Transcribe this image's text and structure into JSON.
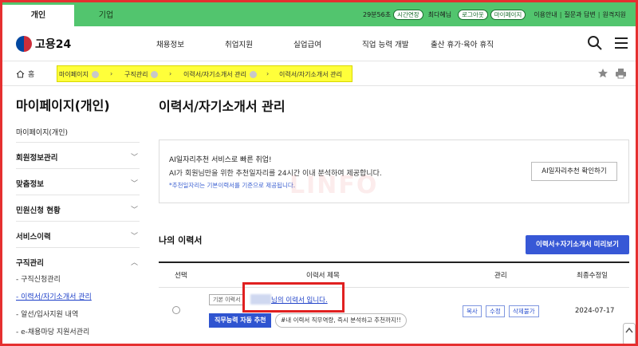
{
  "topbar": {
    "tabs": [
      "개인",
      "기업"
    ],
    "session_time": "29분56초",
    "extend_label": "시간연장",
    "user": "최다혜님",
    "logout_label": "로그아웃",
    "mypage_label": "마이페이지",
    "links": [
      "이용안내",
      "질문과 답변",
      "원격지원"
    ]
  },
  "header": {
    "logo": "고용24",
    "menu": [
      "채용정보",
      "취업지원",
      "실업급여",
      "직업 능력 개발",
      "출산 휴가·육아 휴직"
    ]
  },
  "breadcrumb": {
    "home": "홈",
    "items": [
      "마이페이지",
      "구직관리",
      "이력서/자기소개서 관리",
      "이력서/자기소개서 관리"
    ]
  },
  "sidebar": {
    "title": "마이페이지(개인)",
    "subtitle": "마이페이지(개인)",
    "items": [
      "회원정보관리",
      "맞춤정보",
      "민원신청 현황",
      "서비스이력",
      "구직관리"
    ],
    "sublinks": [
      "- 구직신청관리",
      "- 이력서/자기소개서 관리",
      "- 알선/입사지원 내역",
      "- e-채용마당 지원서관리"
    ]
  },
  "main": {
    "title": "이력서/자기소개서 관리",
    "ai_box": {
      "line1": "AI일자리추천 서비스로 빠른 취업!",
      "line2": "AI가 회원님만을 위한 추천일자리를 24시간 이내 분석하여 제공합니다.",
      "note": "*추천일자리는 기본이력서를 기준으로 제공됩니다.",
      "button": "AI일자리추천 확인하기"
    },
    "watermark": "LINFO",
    "my_resume_title": "나의 이력서",
    "preview_button": "이력서+자기소개서 미리보기",
    "table": {
      "headers": [
        "선택",
        "이력서 제목",
        "관리",
        "최종수정일"
      ],
      "row": {
        "base_tag": "기본 이력서",
        "title": "님의 이력서 입니다.",
        "auto_button": "직무능력 자동 추천",
        "hashtag": "#내 이력서 직무역량, 즉시 분석하고 추천까지!!",
        "actions": [
          "복사",
          "수정",
          "삭제불가"
        ],
        "date": "2024-07-17"
      }
    }
  },
  "colors": {
    "topbar": "#52c56e",
    "primary": "#3758d6",
    "highlight": "#ffff3a",
    "annotation": "#e02020"
  }
}
